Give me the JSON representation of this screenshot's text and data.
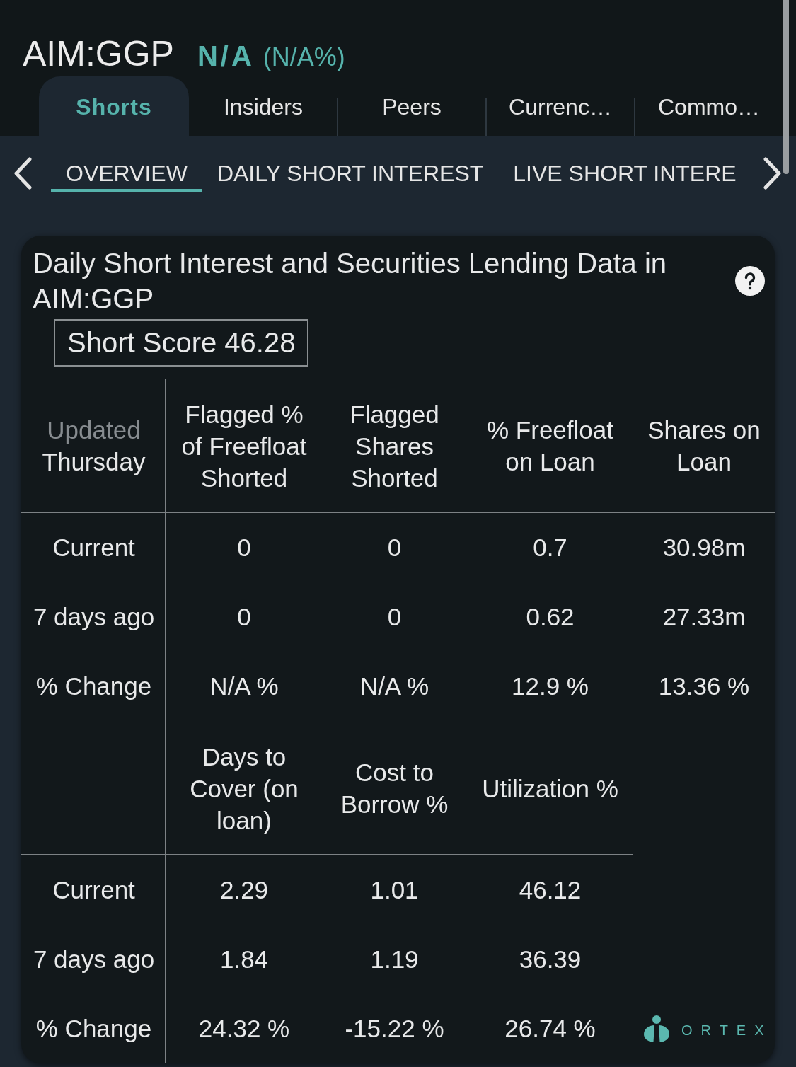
{
  "header": {
    "symbol": "AIM:GGP",
    "price": "N/A",
    "change": "(N/A%)"
  },
  "tabs": [
    {
      "label": "Shorts",
      "selected": true
    },
    {
      "label": "Insiders",
      "selected": false
    },
    {
      "label": "Peers",
      "selected": false
    },
    {
      "label": "Currenc…",
      "selected": false
    },
    {
      "label": "Commo…",
      "selected": false
    }
  ],
  "subtabs": [
    {
      "label": "OVERVIEW",
      "selected": true
    },
    {
      "label": "DAILY SHORT INTEREST",
      "selected": false
    },
    {
      "label": "LIVE SHORT INTERE",
      "selected": false
    }
  ],
  "card": {
    "title": "Daily Short Interest and Securities Lending Data in AIM:GGP",
    "short_score": "Short Score 46.28",
    "sections": [
      {
        "corner": {
          "label": "Updated",
          "value": "Thursday"
        },
        "columns": [
          "Flagged % of Freefloat Shorted",
          "Flagged Shares Shorted",
          "% Freefloat on Loan",
          "Shares on Loan"
        ],
        "rows": [
          {
            "label": "Current",
            "values": [
              "0",
              "0",
              "0.7",
              "30.98m"
            ]
          },
          {
            "label": "7 days ago",
            "values": [
              "0",
              "0",
              "0.62",
              "27.33m"
            ]
          },
          {
            "label": "% Change",
            "values": [
              "N/A %",
              "N/A %",
              "12.9 %",
              "13.36 %"
            ]
          }
        ]
      },
      {
        "columns": [
          "Days to Cover (on loan)",
          "Cost to Borrow %",
          "Utilization %"
        ],
        "rows": [
          {
            "label": "Current",
            "values": [
              "2.29",
              "1.01",
              "46.12"
            ]
          },
          {
            "label": "7 days ago",
            "values": [
              "1.84",
              "1.19",
              "36.39"
            ]
          },
          {
            "label": "% Change",
            "values": [
              "24.32 %",
              "-15.22 %",
              "26.74 %"
            ]
          }
        ]
      }
    ],
    "brand": "ORTEX"
  }
}
